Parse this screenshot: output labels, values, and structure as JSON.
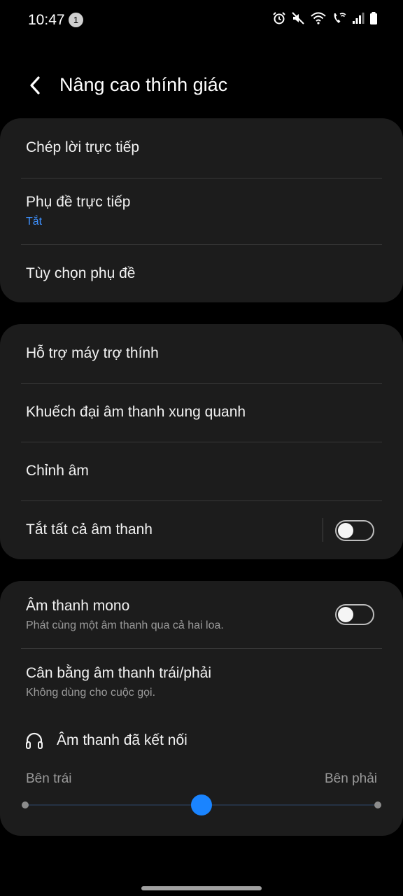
{
  "status_bar": {
    "time": "10:47",
    "notification_count": "1",
    "icons": [
      "alarm-icon",
      "mute-icon",
      "wifi-icon",
      "wifi-calling-icon",
      "signal-icon",
      "battery-icon"
    ]
  },
  "header": {
    "back_icon": "chevron-left-icon",
    "title": "Nâng cao thính giác"
  },
  "group1": {
    "live_transcribe": "Chép lời trực tiếp",
    "live_caption": {
      "title": "Phụ đề trực tiếp",
      "status": "Tắt"
    },
    "caption_options": "Tùy chọn phụ đề"
  },
  "group2": {
    "hearing_aid": "Hỗ trợ máy trợ thính",
    "amplify_ambient": "Khuếch đại âm thanh xung quanh",
    "adapt_sound": "Chỉnh âm",
    "mute_all": {
      "title": "Tắt tất cả âm thanh",
      "enabled": false
    }
  },
  "group3": {
    "mono_audio": {
      "title": "Âm thanh mono",
      "description": "Phát cùng một âm thanh qua cả hai loa.",
      "enabled": false
    },
    "balance": {
      "title": "Cân bằng âm thanh trái/phải",
      "description": "Không dùng cho cuộc gọi."
    },
    "connected_audio": {
      "icon": "headphones-icon",
      "label": "Âm thanh đã kết nối"
    },
    "slider": {
      "left_label": "Bên trái",
      "right_label": "Bên phải",
      "value": 0.5
    }
  },
  "colors": {
    "background": "#000000",
    "card": "#1c1c1c",
    "accent": "#1a84ff",
    "status_blue": "#3e91ff"
  }
}
